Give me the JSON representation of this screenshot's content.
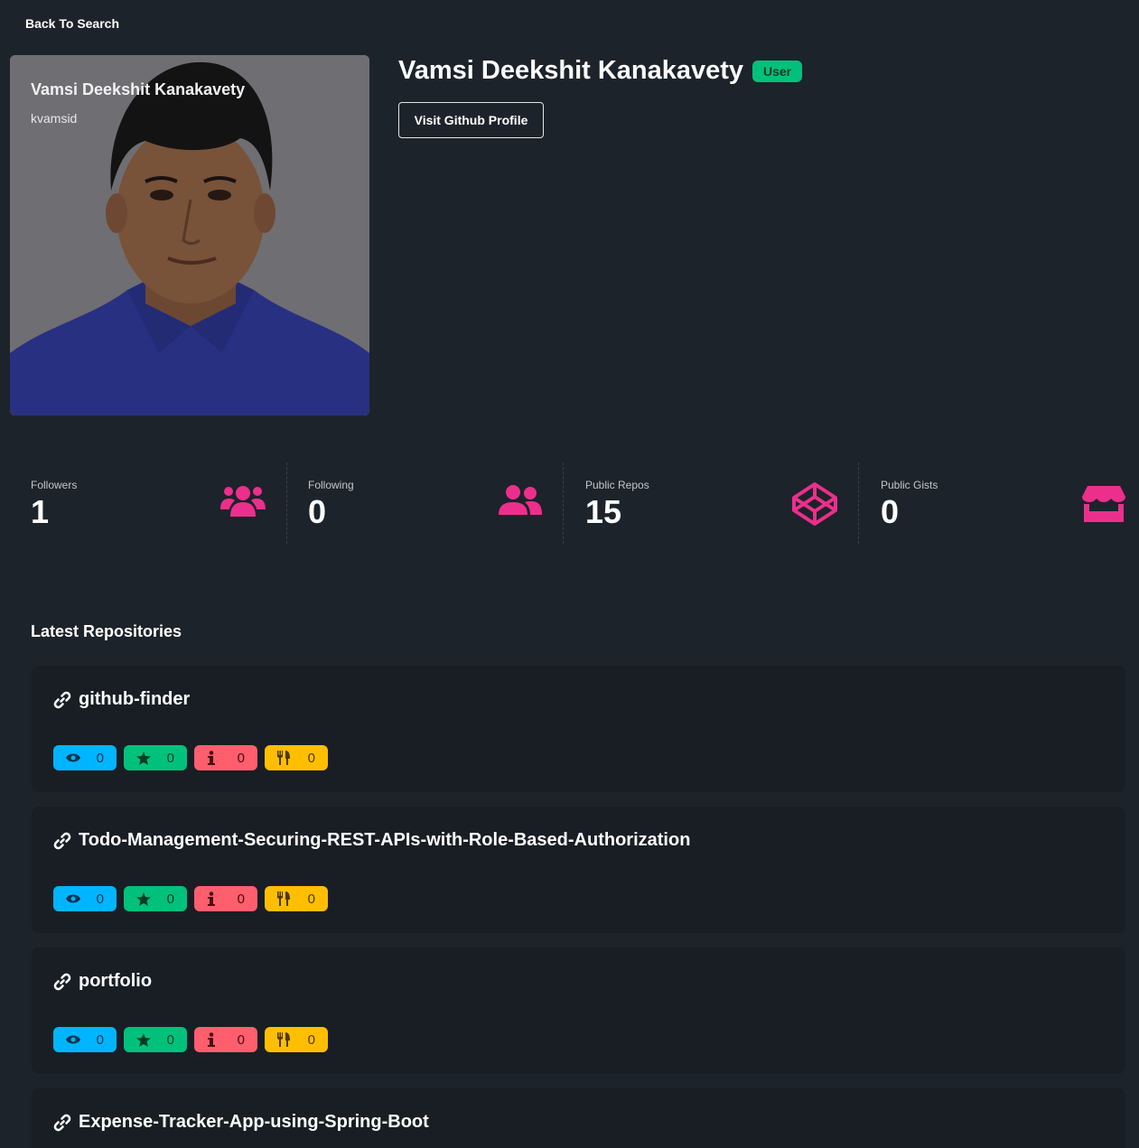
{
  "nav": {
    "back_label": "Back To Search"
  },
  "profile": {
    "name": "Vamsi Deekshit Kanakavety",
    "login": "kvamsid",
    "type_badge": "User",
    "visit_label": "Visit Github Profile"
  },
  "stats": [
    {
      "label": "Followers",
      "value": "1",
      "icon": "users-icon"
    },
    {
      "label": "Following",
      "value": "0",
      "icon": "user-friends-icon"
    },
    {
      "label": "Public Repos",
      "value": "15",
      "icon": "codepen-icon"
    },
    {
      "label": "Public Gists",
      "value": "0",
      "icon": "store-icon"
    }
  ],
  "repos_section": {
    "title": "Latest Repositories"
  },
  "repos": [
    {
      "name": "github-finder",
      "watchers": "0",
      "stars": "0",
      "issues": "0",
      "forks": "0"
    },
    {
      "name": "Todo-Management-Securing-REST-APIs-with-Role-Based-Authorization",
      "watchers": "0",
      "stars": "0",
      "issues": "0",
      "forks": "0"
    },
    {
      "name": "portfolio",
      "watchers": "0",
      "stars": "0",
      "issues": "0",
      "forks": "0"
    },
    {
      "name": "Expense-Tracker-App-using-Spring-Boot"
    }
  ],
  "colors": {
    "background": "#1d232a",
    "card": "#191e24",
    "accent_pink": "#ec2f8c",
    "badge_user": "#00c17c",
    "watch": "#00b5ff",
    "star": "#00c17c",
    "issue": "#ff5e6d",
    "fork": "#ffbe00"
  }
}
